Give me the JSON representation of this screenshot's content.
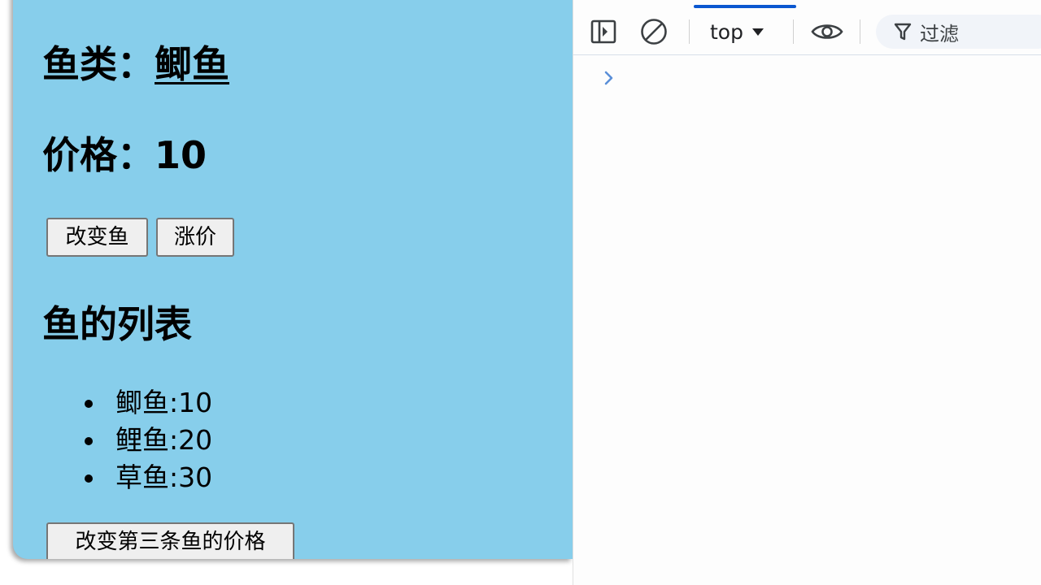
{
  "app": {
    "fish_label": "鱼类：",
    "fish_value": "鲫鱼",
    "price_label": "价格：",
    "price_value": "10",
    "buttons": {
      "change_fish": "改变鱼",
      "raise_price": "涨价",
      "change_third_price": "改变第三条鱼的价格"
    },
    "list_heading": "鱼的列表",
    "fish_list": [
      "鲫鱼:10",
      "鲤鱼:20",
      "草鱼:30"
    ],
    "background_color": "#87ceeb"
  },
  "devtools": {
    "context": "top",
    "filter_placeholder": "过滤",
    "icons": [
      "sidebar-toggle-icon",
      "clear-console-icon",
      "dropdown-caret-icon",
      "live-expression-eye-icon",
      "filter-icon",
      "console-prompt-chevron-icon"
    ],
    "accent_color": "#0b57d0"
  }
}
